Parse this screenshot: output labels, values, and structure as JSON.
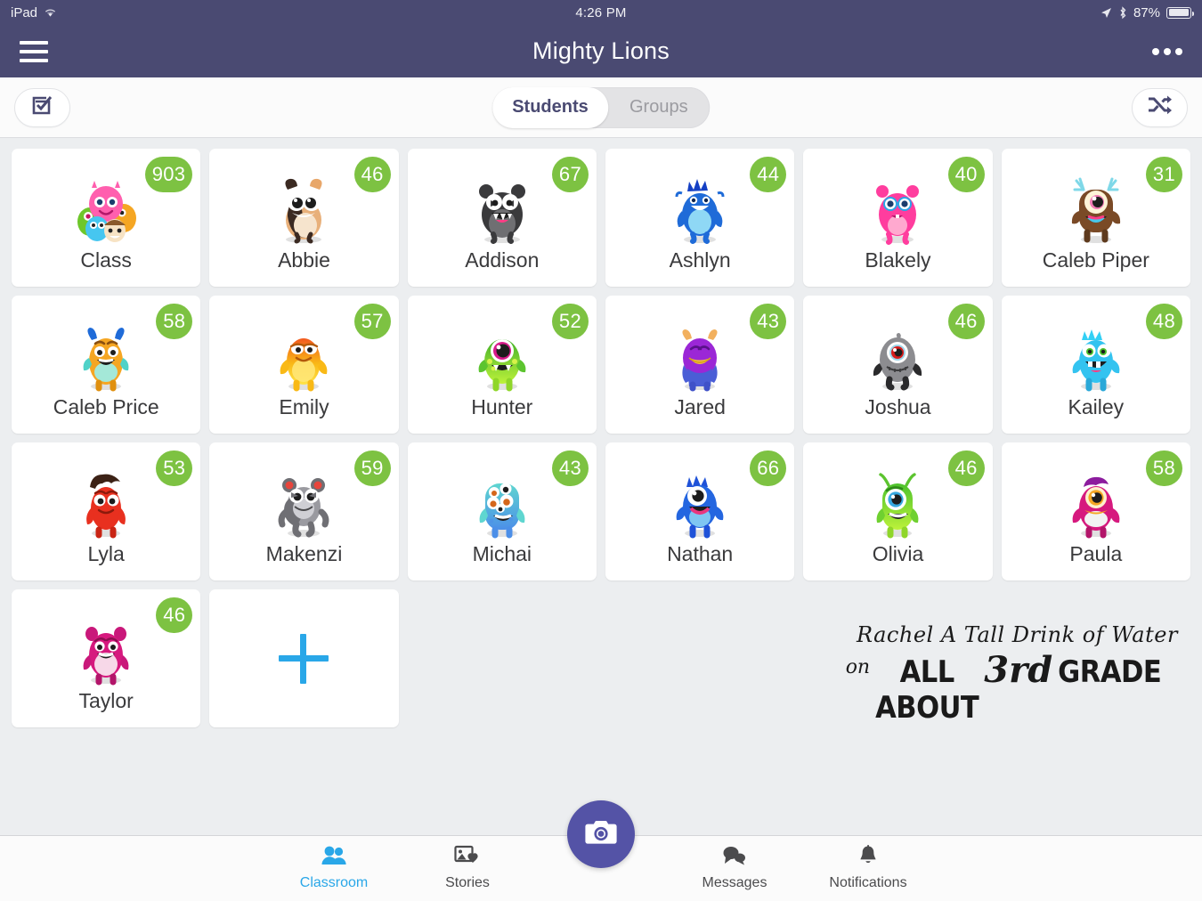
{
  "status_bar": {
    "device": "iPad",
    "wifi_icon": "wifi-icon",
    "time": "4:26 PM",
    "location_icon": "location-arrow-icon",
    "bluetooth_icon": "bluetooth-icon",
    "battery_percent": "87%",
    "battery_level": 87
  },
  "nav": {
    "menu_icon": "hamburger-menu-icon",
    "title": "Mighty Lions",
    "more_icon": "more-options-icon"
  },
  "toolbar": {
    "checklist_icon": "checklist-icon",
    "shuffle_icon": "shuffle-icon",
    "segments": [
      {
        "label": "Students",
        "active": true
      },
      {
        "label": "Groups",
        "active": false
      }
    ]
  },
  "colors": {
    "nav_purple": "#4a4a72",
    "badge_green": "#7dc242",
    "accent_blue": "#29a7e8",
    "fab_purple": "#5453a6",
    "page_bg": "#eceef0"
  },
  "roster": {
    "add_button_icon": "plus-icon",
    "cards": [
      {
        "name": "Class",
        "points": "903",
        "avatar": "class-group-monsters"
      },
      {
        "name": "Abbie",
        "points": "46",
        "avatar": "tan-black-ferret-monster"
      },
      {
        "name": "Addison",
        "points": "67",
        "avatar": "dark-gray-fanged-monster"
      },
      {
        "name": "Ashlyn",
        "points": "44",
        "avatar": "blue-spiky-hair-monster"
      },
      {
        "name": "Blakely",
        "points": "40",
        "avatar": "pink-furry-monster"
      },
      {
        "name": "Caleb Piper",
        "points": "31",
        "avatar": "brown-antler-cyclops-monster"
      },
      {
        "name": "Caleb Price",
        "points": "58",
        "avatar": "orange-horned-monster"
      },
      {
        "name": "Emily",
        "points": "57",
        "avatar": "yellow-orange-glow-monster"
      },
      {
        "name": "Hunter",
        "points": "52",
        "avatar": "green-cyclops-monster"
      },
      {
        "name": "Jared",
        "points": "43",
        "avatar": "purple-beak-monster"
      },
      {
        "name": "Joshua",
        "points": "46",
        "avatar": "gray-furry-cyclops-monster"
      },
      {
        "name": "Kailey",
        "points": "48",
        "avatar": "cyan-furry-monster"
      },
      {
        "name": "Lyla",
        "points": "53",
        "avatar": "red-hair-monster"
      },
      {
        "name": "Makenzi",
        "points": "59",
        "avatar": "gray-bear-monster"
      },
      {
        "name": "Michai",
        "points": "43",
        "avatar": "teal-many-eyes-monster"
      },
      {
        "name": "Nathan",
        "points": "66",
        "avatar": "blue-furry-cyclops-monster"
      },
      {
        "name": "Olivia",
        "points": "46",
        "avatar": "green-antenna-cyclops-monster"
      },
      {
        "name": "Paula",
        "points": "58",
        "avatar": "magenta-cyclops-monster"
      },
      {
        "name": "Taylor",
        "points": "46",
        "avatar": "pink-eared-monster"
      }
    ]
  },
  "watermark": {
    "line1": "Rachel A Tall Drink of Water",
    "on": "on",
    "all_about": "ALL ABOUT",
    "third": "3rd",
    "grade": "GRADE"
  },
  "tabbar": {
    "camera_icon": "camera-icon",
    "tabs": [
      {
        "label": "Classroom",
        "icon": "people-icon",
        "active": true
      },
      {
        "label": "Stories",
        "icon": "photo-heart-icon",
        "active": false
      },
      {
        "label": "Messages",
        "icon": "chat-bubbles-icon",
        "active": false
      },
      {
        "label": "Notifications",
        "icon": "bell-icon",
        "active": false
      }
    ]
  }
}
